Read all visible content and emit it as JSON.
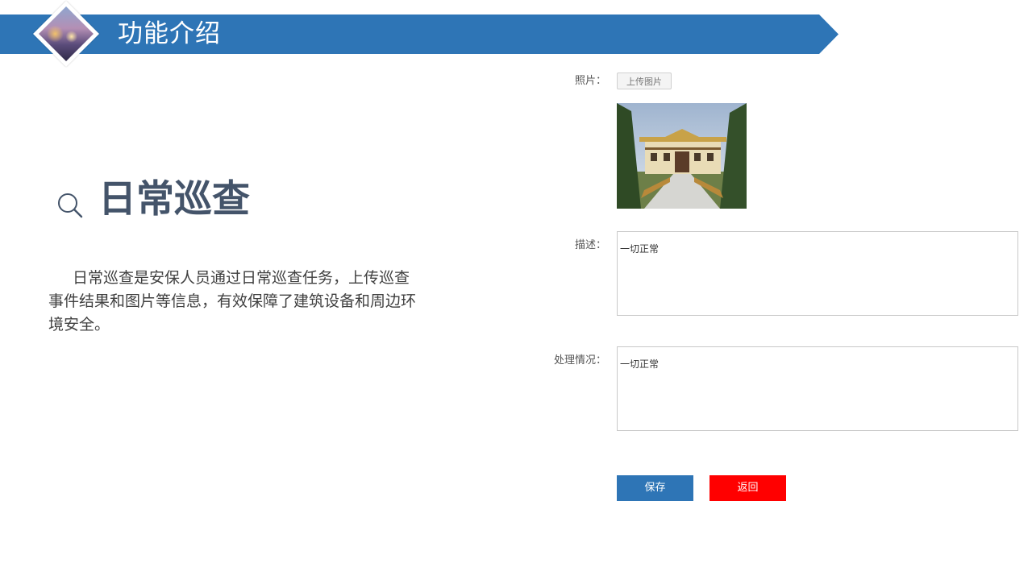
{
  "header": {
    "title": "功能介绍"
  },
  "section": {
    "title": "日常巡查",
    "description": "日常巡查是安保人员通过日常巡查任务，上传巡查事件结果和图片等信息，有效保障了建筑设备和周边环境安全。"
  },
  "form": {
    "photo_label": "照片：",
    "upload_button": "上传图片",
    "description_label": "描述：",
    "description_value": "一切正常",
    "handling_label": "处理情况：",
    "handling_value": "一切正常",
    "save_button": "保存",
    "back_button": "返回"
  },
  "colors": {
    "accent": "#2e75b6",
    "danger": "#ff0000",
    "title_text": "#44546a"
  }
}
